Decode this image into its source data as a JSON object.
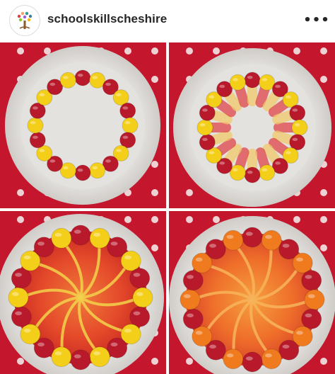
{
  "post": {
    "username": "schoolskillscheshire",
    "more_label": "•••",
    "avatar_icon": "child-tree-logo-icon",
    "more_icon": "more-options-icon"
  },
  "photo": {
    "description_icon": "skittles-rainbow-experiment-photo",
    "panel_count": 4,
    "colors": {
      "tablecloth": "#c4162d",
      "bowl": "#e8e6e3",
      "red_candy": "#b8192b",
      "yellow_candy": "#f4cf1a",
      "orange_candy": "#f07a1e"
    }
  }
}
